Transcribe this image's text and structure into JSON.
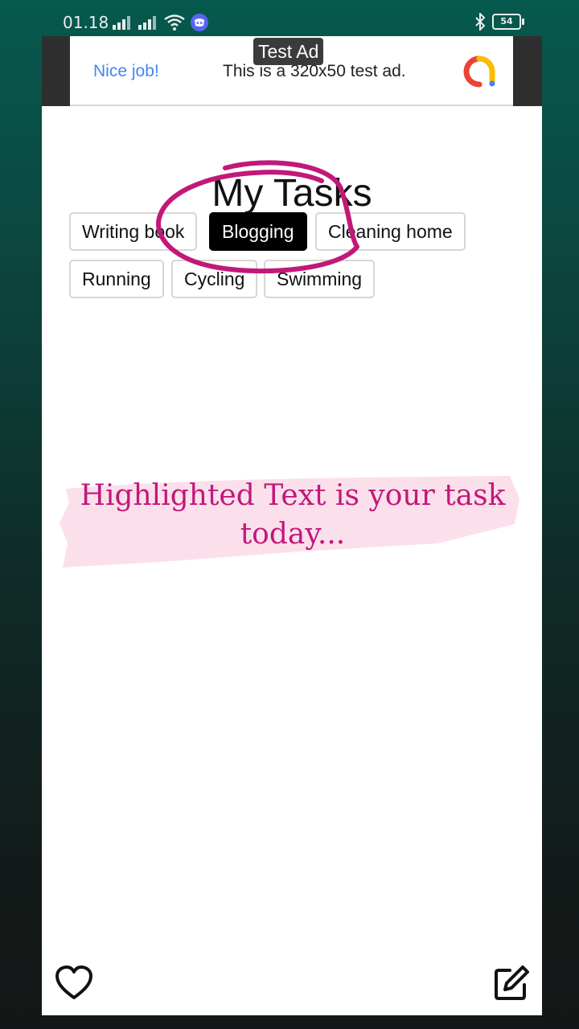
{
  "status_bar": {
    "time": "01.18",
    "battery": "54",
    "icons": [
      "signal-icon",
      "signal-icon",
      "wifi-icon",
      "discord-icon",
      "bluetooth-icon",
      "battery-icon"
    ]
  },
  "ad": {
    "badge": "Test Ad",
    "nice": "Nice job!",
    "text": "This is a 320x50 test ad."
  },
  "page": {
    "title": "My Tasks",
    "tasks": [
      {
        "label": "Writing book",
        "selected": false
      },
      {
        "label": "Blogging",
        "selected": true
      },
      {
        "label": "Cleaning home",
        "selected": false
      },
      {
        "label": "Running",
        "selected": false
      },
      {
        "label": "Cycling",
        "selected": false
      },
      {
        "label": "Swimming",
        "selected": false
      }
    ],
    "highlight_line1": "Highlighted Text is your task",
    "highlight_line2": "today..."
  },
  "bottom": {
    "left_icon": "heart-icon",
    "right_icon": "edit-icon"
  },
  "colors": {
    "accent_pink": "#c2187a",
    "highlight_bg": "#fbe0ec",
    "ad_blue": "#4285f4"
  }
}
